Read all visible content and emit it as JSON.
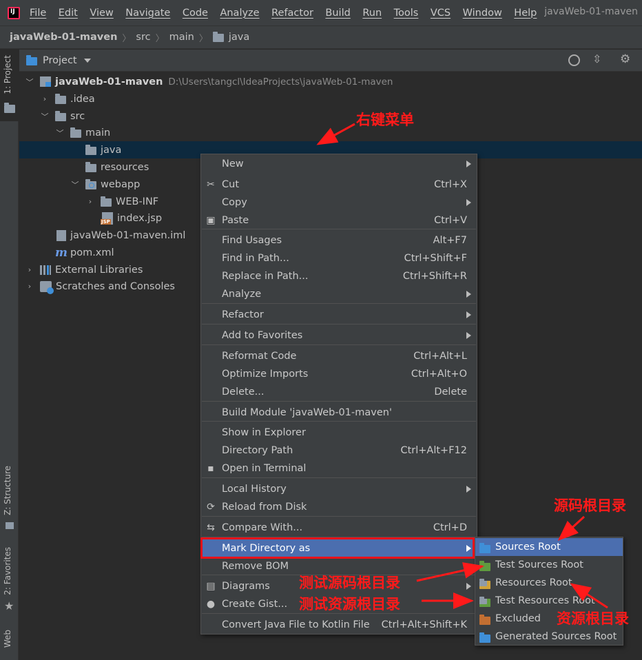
{
  "menubar": {
    "items": [
      "File",
      "Edit",
      "View",
      "Navigate",
      "Code",
      "Analyze",
      "Refactor",
      "Build",
      "Run",
      "Tools",
      "VCS",
      "Window",
      "Help"
    ],
    "window_title": "javaWeb-01-maven"
  },
  "breadcrumb": [
    "javaWeb-01-maven",
    "src",
    "main",
    "java"
  ],
  "left_tabs": {
    "project": "1: Project",
    "structure": "Z: Structure",
    "favorites": "2: Favorites",
    "web": "Web"
  },
  "panel": {
    "title": "Project"
  },
  "tree": [
    {
      "label": "javaWeb-01-maven",
      "path": "D:\\Users\\tangcl\\IdeaProjects\\javaWeb-01-maven",
      "icon": "module-icon"
    },
    {
      "label": ".idea",
      "icon": "folder-icon"
    },
    {
      "label": "src",
      "icon": "folder-icon"
    },
    {
      "label": "main",
      "icon": "folder-icon"
    },
    {
      "label": "java",
      "icon": "folder-icon"
    },
    {
      "label": "resources",
      "icon": "folder-icon"
    },
    {
      "label": "webapp",
      "icon": "web-folder-icon"
    },
    {
      "label": "WEB-INF",
      "icon": "folder-icon"
    },
    {
      "label": "index.jsp",
      "icon": "jsp-file-icon"
    },
    {
      "label": "javaWeb-01-maven.iml",
      "icon": "iml-file-icon"
    },
    {
      "label": "pom.xml",
      "icon": "maven-icon"
    },
    {
      "label": "External Libraries",
      "icon": "library-icon"
    },
    {
      "label": "Scratches and Consoles",
      "icon": "scratch-icon"
    }
  ],
  "context_menu": [
    {
      "label": "New",
      "shortcut": "",
      "submenu": true,
      "icon": ""
    },
    {
      "label": "Cut",
      "shortcut": "Ctrl+X",
      "submenu": false,
      "icon": "scissors-icon"
    },
    {
      "label": "Copy",
      "shortcut": "",
      "submenu": true,
      "icon": ""
    },
    {
      "label": "Paste",
      "shortcut": "Ctrl+V",
      "submenu": false,
      "icon": "clipboard-icon"
    },
    {
      "label": "Find Usages",
      "shortcut": "Alt+F7",
      "submenu": false,
      "icon": ""
    },
    {
      "label": "Find in Path...",
      "shortcut": "Ctrl+Shift+F",
      "submenu": false,
      "icon": ""
    },
    {
      "label": "Replace in Path...",
      "shortcut": "Ctrl+Shift+R",
      "submenu": false,
      "icon": ""
    },
    {
      "label": "Analyze",
      "shortcut": "",
      "submenu": true,
      "icon": ""
    },
    {
      "label": "Refactor",
      "shortcut": "",
      "submenu": true,
      "icon": ""
    },
    {
      "label": "Add to Favorites",
      "shortcut": "",
      "submenu": true,
      "icon": ""
    },
    {
      "label": "Reformat Code",
      "shortcut": "Ctrl+Alt+L",
      "submenu": false,
      "icon": ""
    },
    {
      "label": "Optimize Imports",
      "shortcut": "Ctrl+Alt+O",
      "submenu": false,
      "icon": ""
    },
    {
      "label": "Delete...",
      "shortcut": "Delete",
      "submenu": false,
      "icon": ""
    },
    {
      "label": "Build Module 'javaWeb-01-maven'",
      "shortcut": "",
      "submenu": false,
      "icon": ""
    },
    {
      "label": "Show in Explorer",
      "shortcut": "",
      "submenu": false,
      "icon": ""
    },
    {
      "label": "Directory Path",
      "shortcut": "Ctrl+Alt+F12",
      "submenu": false,
      "icon": ""
    },
    {
      "label": "Open in Terminal",
      "shortcut": "",
      "submenu": false,
      "icon": "terminal-icon"
    },
    {
      "label": "Local History",
      "shortcut": "",
      "submenu": true,
      "icon": ""
    },
    {
      "label": "Reload from Disk",
      "shortcut": "",
      "submenu": false,
      "icon": "reload-icon"
    },
    {
      "label": "Compare With...",
      "shortcut": "Ctrl+D",
      "submenu": false,
      "icon": "compare-icon"
    },
    {
      "label": "Mark Directory as",
      "shortcut": "",
      "submenu": true,
      "icon": ""
    },
    {
      "label": "Remove BOM",
      "shortcut": "",
      "submenu": false,
      "icon": ""
    },
    {
      "label": "Diagrams",
      "shortcut": "",
      "submenu": true,
      "icon": "diagram-icon"
    },
    {
      "label": "Create Gist...",
      "shortcut": "",
      "submenu": false,
      "icon": "github-icon"
    },
    {
      "label": "Convert Java File to Kotlin File",
      "shortcut": "Ctrl+Alt+Shift+K",
      "submenu": false,
      "icon": ""
    }
  ],
  "submenu": [
    {
      "label": "Sources Root",
      "icon": "sources-root-folder-icon"
    },
    {
      "label": "Test Sources Root",
      "icon": "test-sources-root-folder-icon"
    },
    {
      "label": "Resources Root",
      "icon": "resources-root-folder-icon"
    },
    {
      "label": "Test Resources Root",
      "icon": "test-resources-root-folder-icon"
    },
    {
      "label": "Excluded",
      "icon": "excluded-folder-icon"
    },
    {
      "label": "Generated Sources Root",
      "icon": "generated-sources-root-folder-icon"
    }
  ],
  "annotations": {
    "right_click_menu": "右键菜单",
    "sources_root": "源码根目录",
    "test_sources_root": "测试源码根目录",
    "test_resources_root": "测试资源根目录",
    "resources_root": "资源根目录"
  },
  "colors": {
    "annotation": "#ff1a1a",
    "selection": "#4b6eaf",
    "tree_selection": "#0d293e"
  }
}
